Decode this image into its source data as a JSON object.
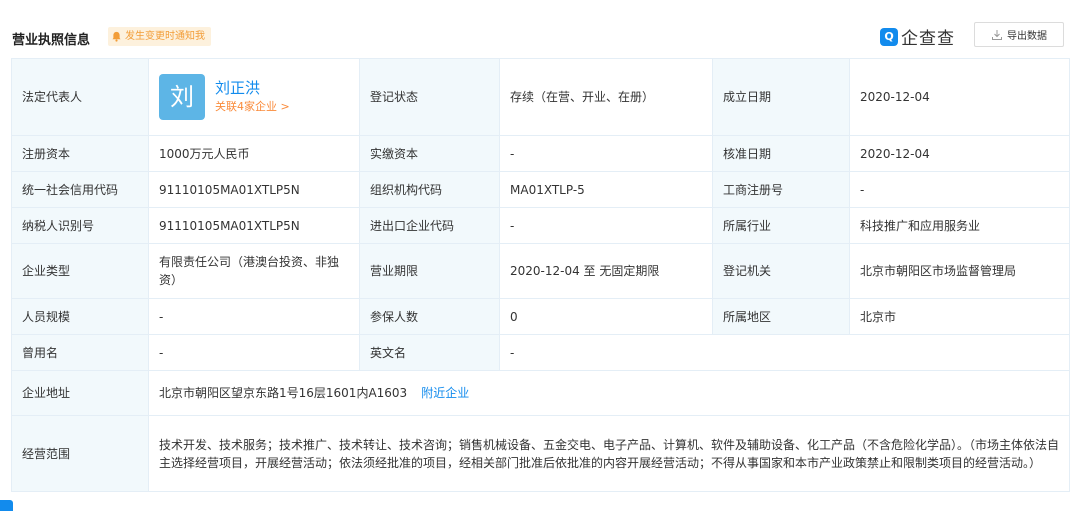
{
  "header": {
    "title": "营业执照信息",
    "notify_label": "发生变更时通知我",
    "logo_badge": "Q",
    "logo_text": "企查查",
    "export_label": "导出数据"
  },
  "rows": {
    "legal_rep": {
      "label": "法定代表人",
      "avatar_char": "刘",
      "name": "刘正洪",
      "related": "关联4家企业 >",
      "reg_status_label": "登记状态",
      "reg_status_value": "存续（在营、开业、在册）",
      "found_date_label": "成立日期",
      "found_date_value": "2020-12-04"
    },
    "capital": {
      "label": "注册资本",
      "value": "1000万元人民币",
      "paid_label": "实缴资本",
      "paid_value": "-",
      "approve_label": "核准日期",
      "approve_value": "2020-12-04"
    },
    "credit": {
      "label": "统一社会信用代码",
      "value": "91110105MA01XTLP5N",
      "org_label": "组织机构代码",
      "org_value": "MA01XTLP-5",
      "biz_reg_label": "工商注册号",
      "biz_reg_value": "-"
    },
    "tax": {
      "label": "纳税人识别号",
      "value": "91110105MA01XTLP5N",
      "ie_label": "进出口企业代码",
      "ie_value": "-",
      "industry_label": "所属行业",
      "industry_value": "科技推广和应用服务业"
    },
    "type": {
      "label": "企业类型",
      "value": "有限责任公司（港澳台投资、非独资）",
      "term_label": "营业期限",
      "term_value": "2020-12-04 至 无固定期限",
      "authority_label": "登记机关",
      "authority_value": "北京市朝阳区市场监督管理局"
    },
    "staff": {
      "label": "人员规模",
      "value": "-",
      "insured_label": "参保人数",
      "insured_value": "0",
      "region_label": "所属地区",
      "region_value": "北京市"
    },
    "former": {
      "label": "曾用名",
      "value": "-",
      "english_label": "英文名",
      "english_value": "-"
    },
    "address": {
      "label": "企业地址",
      "value": "北京市朝阳区望京东路1号16层1601内A1603",
      "nearby": "附近企业"
    },
    "scope": {
      "label": "经营范围",
      "value": "技术开发、技术服务；技术推广、技术转让、技术咨询；销售机械设备、五金交电、电子产品、计算机、软件及辅助设备、化工产品（不含危险化学品）。（市场主体依法自主选择经营项目，开展经营活动；依法须经批准的项目，经相关部门批准后依批准的内容开展经营活动；不得从事国家和本市产业政策禁止和限制类项目的经营活动。）"
    }
  }
}
